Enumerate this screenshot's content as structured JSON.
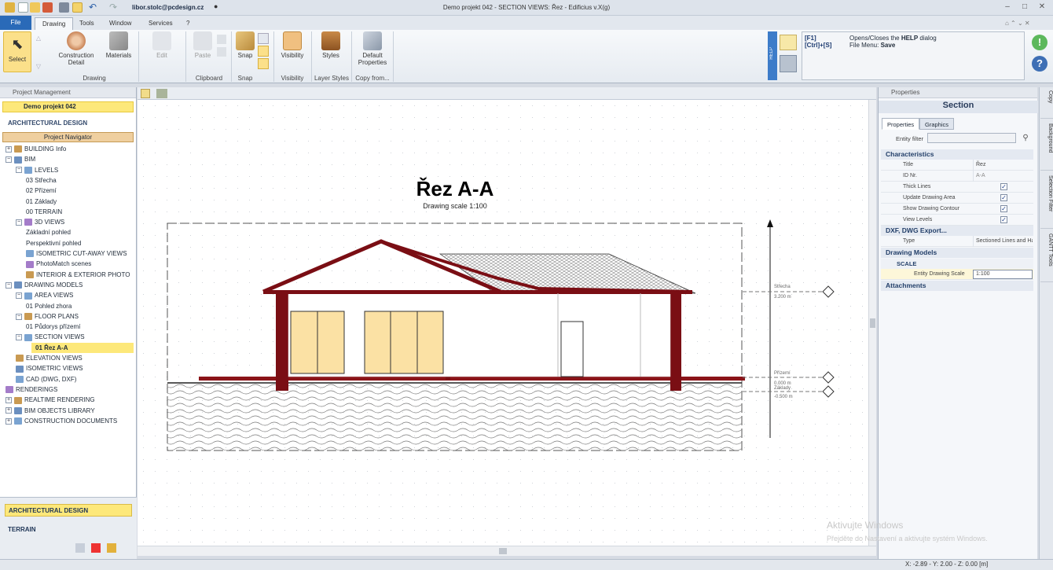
{
  "titlebar": {
    "user_email": "libor.stolc@pcdesign.cz",
    "title": "Demo projekt 042 - SECTION VIEWS: Řez - Edificius v.X(g)"
  },
  "ribbon_tabs": [
    "File",
    "Drawing",
    "Tools",
    "Window",
    "Services",
    "?"
  ],
  "ribbon": {
    "select": "Select",
    "construction_detail": "Construction Detail",
    "materials": "Materials",
    "edit": "Edit",
    "paste": "Paste",
    "snap": "Snap",
    "visibility": "Visibility",
    "styles": "Styles",
    "default_properties": "Default Properties",
    "groups": {
      "drawing": "Drawing",
      "clipboard": "Clipboard",
      "snap": "Snap",
      "visibility": "Visibility",
      "layer_styles": "Layer Styles",
      "copy_from": "Copy from..."
    },
    "help_strip": "HELP",
    "help_keys": [
      "[F1]",
      "[Ctrl]+[S]"
    ],
    "help_desc_1_pre": "Opens/Closes the ",
    "help_desc_1_bold": "HELP",
    "help_desc_1_post": " dialog",
    "help_desc_2_pre": "File Menu: ",
    "help_desc_2_bold": "Save"
  },
  "project_panel": {
    "header": "Project Management",
    "project_name": "Demo projekt 042",
    "section_title": "ARCHITECTURAL DESIGN",
    "navigator": "Project Navigator",
    "tree": [
      {
        "label": "BUILDING Info",
        "level": 0,
        "exp": "+"
      },
      {
        "label": "BIM",
        "level": 0,
        "exp": "−"
      },
      {
        "label": "LEVELS",
        "level": 1,
        "exp": "−"
      },
      {
        "label": "03 Střecha",
        "level": 2
      },
      {
        "label": "02 Přízemí",
        "level": 2
      },
      {
        "label": "01 Základy",
        "level": 2
      },
      {
        "label": "00 TERRAIN",
        "level": 2
      },
      {
        "label": "3D VIEWS",
        "level": 1,
        "exp": "−"
      },
      {
        "label": "Základní pohled",
        "level": 2
      },
      {
        "label": "Perspektivní pohled",
        "level": 2
      },
      {
        "label": "ISOMETRIC CUT-AWAY VIEWS",
        "level": 2,
        "icon": true
      },
      {
        "label": "PhotoMatch scenes",
        "level": 2,
        "icon": true
      },
      {
        "label": "INTERIOR & EXTERIOR PHOTO",
        "level": 2,
        "icon": true
      },
      {
        "label": "DRAWING MODELS",
        "level": 0,
        "exp": "−"
      },
      {
        "label": "AREA VIEWS",
        "level": 1,
        "exp": "−"
      },
      {
        "label": "01 Pohled zhora",
        "level": 2
      },
      {
        "label": "FLOOR PLANS",
        "level": 1,
        "exp": "−"
      },
      {
        "label": "01 Půdorys přízemí",
        "level": 2
      },
      {
        "label": "SECTION VIEWS",
        "level": 1,
        "exp": "−"
      },
      {
        "label": "01 Řez A-A",
        "level": 2,
        "selected": true
      },
      {
        "label": "ELEVATION VIEWS",
        "level": 1,
        "icon": true
      },
      {
        "label": "ISOMETRIC VIEWS",
        "level": 1,
        "icon": true
      },
      {
        "label": "CAD (DWG, DXF)",
        "level": 1,
        "icon": true
      },
      {
        "label": "RENDERINGS",
        "level": 0,
        "icon": true
      },
      {
        "label": "REALTIME RENDERING",
        "level": 0,
        "exp": "+"
      },
      {
        "label": "BIM OBJECTS LIBRARY",
        "level": 0,
        "exp": "+"
      },
      {
        "label": "CONSTRUCTION DOCUMENTS",
        "level": 0,
        "exp": "+"
      }
    ],
    "bottom_tabs": [
      "ARCHITECTURAL DESIGN",
      "TERRAIN"
    ]
  },
  "drawing": {
    "title": "Řez  A-A",
    "scale": "Drawing scale 1:100",
    "levels": [
      {
        "name": "Střecha",
        "value": "3.200 m"
      },
      {
        "name": "Přízemí",
        "value": "0.000 m"
      },
      {
        "name": "Základy",
        "value": "-0.500 m"
      }
    ]
  },
  "properties": {
    "header": "Properties",
    "title": "Section",
    "tabs": [
      "Properties",
      "Graphics"
    ],
    "entity_filter": "Entity filter",
    "categories": {
      "characteristics": "Characteristics",
      "dxf": "DXF, DWG Export...",
      "drawing_models": "Drawing Models",
      "scale": "SCALE",
      "attachments": "Attachments"
    },
    "rows": {
      "title_name": "Title",
      "title_value": "Řez",
      "id_name": "ID Nr.",
      "id_value": "A-A",
      "thick_lines": "Thick Lines",
      "update_area": "Update Drawing Area",
      "show_contour": "Show Drawing Contour",
      "view_levels": "View Levels",
      "type_name": "Type",
      "type_value": "Sectioned Lines and Ha",
      "eds_name": "Entity Drawing Scale",
      "eds_value": "1:100"
    }
  },
  "side_tabs": [
    "Copy",
    "Background",
    "Selection Filter",
    "GANTT Tools"
  ],
  "status": {
    "coords": "X: -2.89 - Y: 2.00 - Z: 0.00 [m]"
  },
  "watermark": {
    "title": "Aktivujte Windows",
    "sub": "Přejděte do Nastavení a aktivujte systém Windows."
  },
  "colors": {
    "accent": "#2a6ab8",
    "highlight": "#fde87a",
    "roof": "#7a0e14"
  }
}
